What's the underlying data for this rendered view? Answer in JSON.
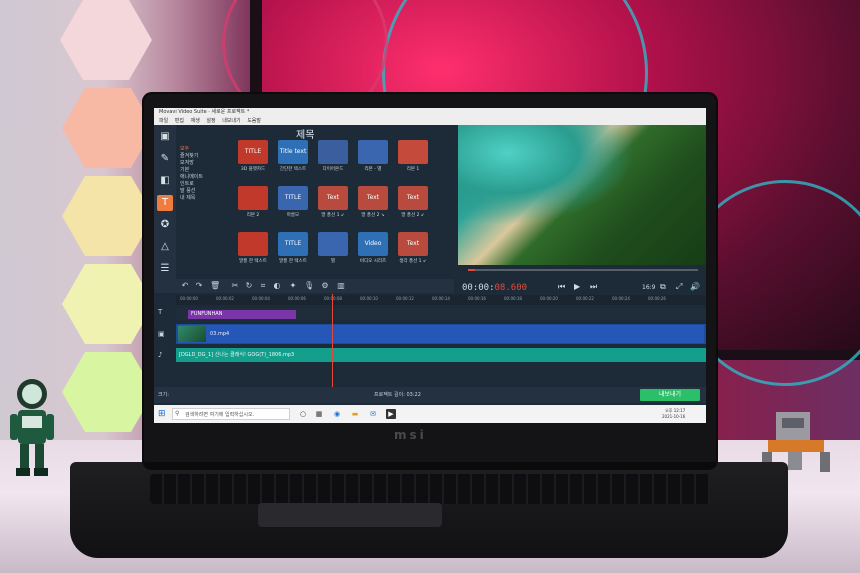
{
  "app": {
    "title": "Movavi Video Suite · 새로운 프로젝트 *",
    "menu": [
      "파일",
      "편집",
      "재생",
      "설정",
      "내보내기",
      "도움말"
    ]
  },
  "left_tools": [
    {
      "icon": "media-icon",
      "active": false
    },
    {
      "icon": "filter-icon",
      "active": false
    },
    {
      "icon": "transition-icon",
      "active": false
    },
    {
      "icon": "title-icon",
      "active": true
    },
    {
      "icon": "sticker-icon",
      "active": false
    },
    {
      "icon": "shape-icon",
      "active": false
    },
    {
      "icon": "more-icon",
      "active": false
    }
  ],
  "panel": {
    "heading": "제목",
    "categories": [
      "모두",
      "즐겨찾기",
      "모져망",
      "기본",
      "애니메이트",
      "인트로",
      "말 풍선",
      "내 제목"
    ],
    "tiles": [
      {
        "thumb": "TITLE",
        "label": "3D 플랫카드",
        "color": "#c0392b"
      },
      {
        "thumb": "Title text here",
        "label": "간단한 텍스트",
        "color": "#2f6fb5"
      },
      {
        "thumb": "",
        "label": "다이어몬드",
        "color": "#3b5f9e"
      },
      {
        "thumb": "",
        "label": "리본 - 별",
        "color": "#3a66b0"
      },
      {
        "thumb": "",
        "label": "리본 1",
        "color": "#c44b3c"
      },
      {
        "thumb": "",
        "label": "리본 2",
        "color": "#c0392b"
      },
      {
        "thumb": "TITLE TEXT",
        "label": "마름모",
        "color": "#3a66b0"
      },
      {
        "thumb": "Text",
        "label": "말 풍선 1 ↙",
        "color": "#b94a3e"
      },
      {
        "thumb": "Text",
        "label": "말 풍선 2 ↘",
        "color": "#b94a3e"
      },
      {
        "thumb": "Text",
        "label": "말 풍선 2 ↙",
        "color": "#b94a3e"
      },
      {
        "thumb": "",
        "label": "말풍 한 텍스트",
        "color": "#c0392b"
      },
      {
        "thumb": "TITLE HERE",
        "label": "말풍 한 텍스트",
        "color": "#2f6fb5"
      },
      {
        "thumb": "",
        "label": "별",
        "color": "#3a66b0"
      },
      {
        "thumb": "Video Series",
        "label": "비디오 시리즈",
        "color": "#2f6fb5"
      },
      {
        "thumb": "Text",
        "label": "생각 풍선 1 ↙",
        "color": "#b94a3e"
      }
    ]
  },
  "player": {
    "timecode_dim": "00:00:",
    "timecode_red": "08.600",
    "aspect": "16:9",
    "progress": 0.03
  },
  "timeline": {
    "ruler": [
      "00:00:00",
      "00:00:02",
      "00:00:04",
      "00:00:06",
      "00:00:08",
      "00:00:10",
      "00:00:12",
      "00:00:14",
      "00:00:16",
      "00:00:18",
      "00:00:20",
      "00:00:22",
      "00:00:24",
      "00:00:26"
    ],
    "title_clip": "FUNFUNHAN",
    "video_clip": "03.mp4",
    "audio_clip": "[DGLD_DG_1] 신나는 클래식! GOG(T)_1806.mp3"
  },
  "bottom": {
    "zoom_label": "크기:",
    "duration_label": "프로젝트 길이: 03:22",
    "export_button": "내보내기"
  },
  "taskbar": {
    "search_placeholder": "검색하려면 여기에 입력하십시오.",
    "clock_time": "오후 12:17",
    "clock_date": "2021-10-16"
  },
  "brand": "msi"
}
